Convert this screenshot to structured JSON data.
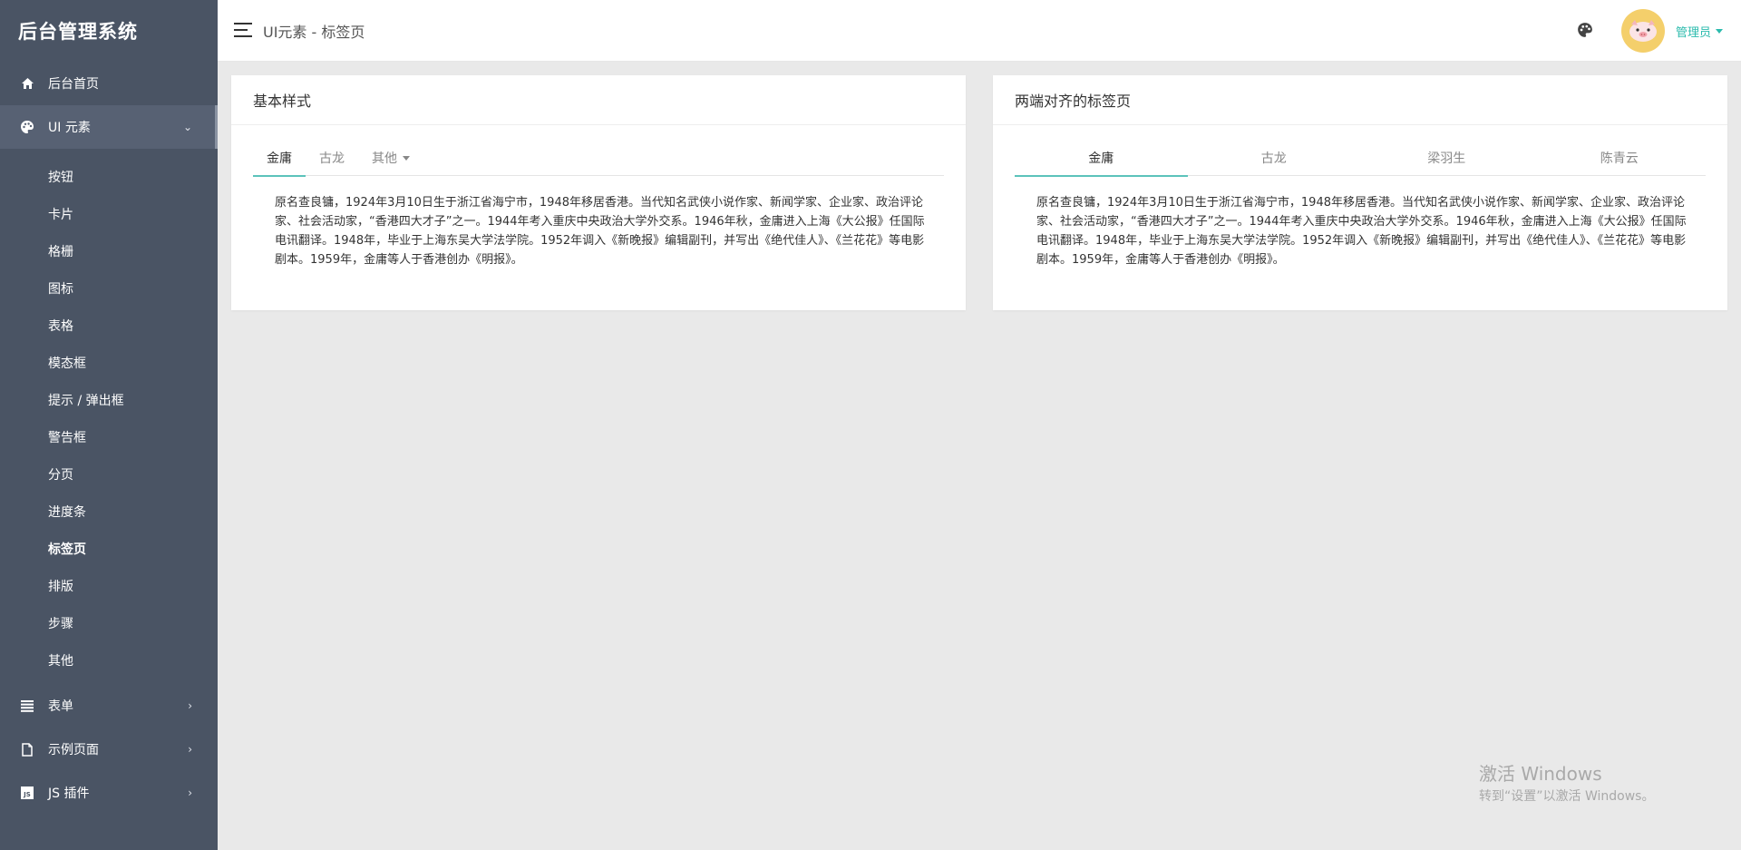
{
  "app": {
    "title": "后台管理系统"
  },
  "header": {
    "page_title": "UI元素 - 标签页",
    "user_label": "管理员",
    "palette_icon": "palette-icon",
    "menu_icon": "hamburger-icon"
  },
  "sidebar": {
    "items": [
      {
        "label": "后台首页",
        "icon": "home-icon"
      },
      {
        "label": "UI 元素",
        "icon": "palette-icon",
        "expanded": true
      },
      {
        "label": "表单",
        "icon": "list-icon"
      },
      {
        "label": "示例页面",
        "icon": "file-icon"
      },
      {
        "label": "JS 插件",
        "icon": "js-icon"
      }
    ],
    "subitems": [
      "按钮",
      "卡片",
      "格栅",
      "图标",
      "表格",
      "模态框",
      "提示 / 弹出框",
      "警告框",
      "分页",
      "进度条",
      "标签页",
      "排版",
      "步骤",
      "其他"
    ],
    "current_subitem": "标签页"
  },
  "cards": [
    {
      "title": "基本样式",
      "tabs": [
        "金庸",
        "古龙",
        "其他"
      ],
      "active_tab": "金庸",
      "content": "原名查良镛，1924年3月10日生于浙江省海宁市，1948年移居香港。当代知名武侠小说作家、新闻学家、企业家、政治评论家、社会活动家，“香港四大才子”之一。1944年考入重庆中央政治大学外交系。1946年秋，金庸进入上海《大公报》任国际电讯翻译。1948年，毕业于上海东吴大学法学院。1952年调入《新晚报》编辑副刊，并写出《绝代佳人》、《兰花花》等电影剧本。1959年，金庸等人于香港创办《明报》。"
    },
    {
      "title": "两端对齐的标签页",
      "tabs": [
        "金庸",
        "古龙",
        "梁羽生",
        "陈青云"
      ],
      "active_tab": "金庸",
      "content": "原名查良镛，1924年3月10日生于浙江省海宁市，1948年移居香港。当代知名武侠小说作家、新闻学家、企业家、政治评论家、社会活动家，“香港四大才子”之一。1944年考入重庆中央政治大学外交系。1946年秋，金庸进入上海《大公报》任国际电讯翻译。1948年，毕业于上海东吴大学法学院。1952年调入《新晚报》编辑副刊，并写出《绝代佳人》、《兰花花》等电影剧本。1959年，金庸等人于香港创办《明报》。"
    }
  ],
  "watermark": {
    "title": "激活 Windows",
    "subtitle": "转到“设置”以激活 Windows。"
  },
  "colors": {
    "sidebar": "#4a5464",
    "sidebar_active": "#576173",
    "accent": "#2bbbad",
    "tab_indicator": "#5cc3bb",
    "avatar_bg": "#f4cf6b",
    "page_bg": "#e9e9e9"
  }
}
